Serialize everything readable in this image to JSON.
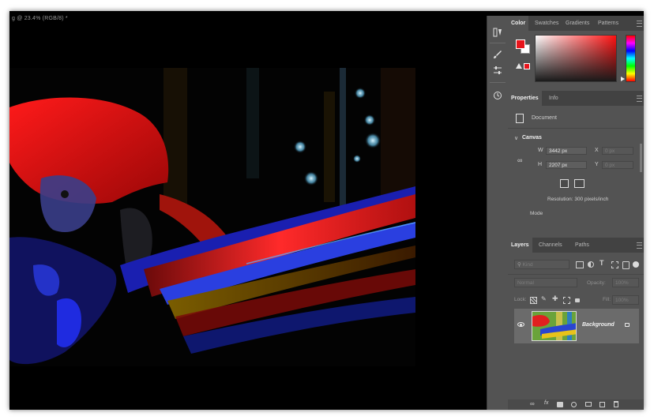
{
  "document": {
    "title": "g @ 23.4% (RGB/8) *"
  },
  "color_panel": {
    "tabs": [
      "Color",
      "Swatches",
      "Gradients",
      "Patterns"
    ],
    "active_tab": 0,
    "foreground": "#e8141b",
    "background": "#ffffff"
  },
  "properties_panel": {
    "tabs": [
      "Properties",
      "Info"
    ],
    "active_tab": 0,
    "doc_label": "Document",
    "section": "Canvas",
    "w_label": "W",
    "w_value": "3442 px",
    "h_label": "H",
    "h_value": "2207 px",
    "x_label": "X",
    "x_value": "0 px",
    "y_label": "Y",
    "y_value": "0 px",
    "resolution": "Resolution: 300 pixels/inch",
    "mode_label": "Mode"
  },
  "layers_panel": {
    "tabs": [
      "Layers",
      "Channels",
      "Paths"
    ],
    "active_tab": 0,
    "kind_placeholder": "Kind",
    "blend_mode": "Normal",
    "opacity_label": "Opacity:",
    "opacity_value": "100%",
    "lock_label": "Lock:",
    "fill_label": "Fill:",
    "fill_value": "100%",
    "layer_name": "Background"
  }
}
